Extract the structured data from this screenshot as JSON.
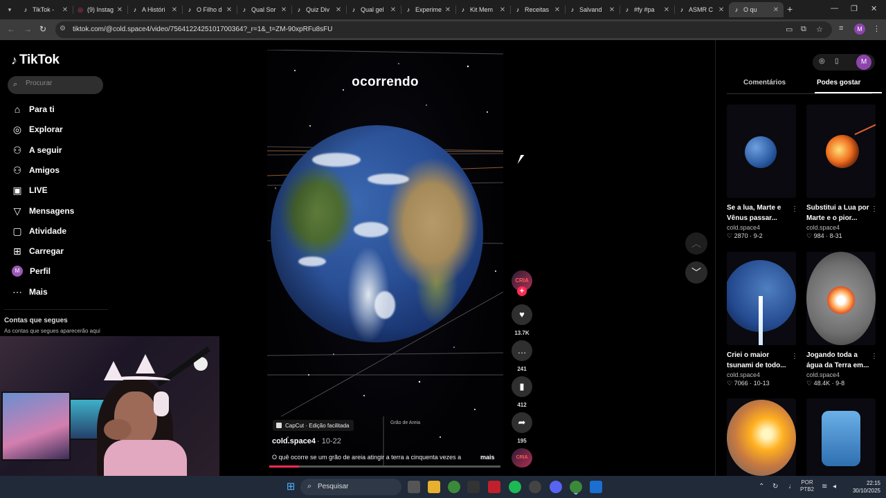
{
  "browser": {
    "tabs": [
      {
        "icon": "tiktok-icon",
        "title": "TikTok -"
      },
      {
        "icon": "instagram-icon",
        "title": "(9) Instag"
      },
      {
        "icon": "tiktok-icon",
        "title": "A Históri"
      },
      {
        "icon": "tiktok-icon",
        "title": "O Filho d"
      },
      {
        "icon": "tiktok-icon",
        "title": "Qual Sor"
      },
      {
        "icon": "tiktok-icon",
        "title": "Quiz Div"
      },
      {
        "icon": "tiktok-icon",
        "title": "Qual gel"
      },
      {
        "icon": "tiktok-icon",
        "title": "Experime"
      },
      {
        "icon": "tiktok-icon",
        "title": "Kit Mem"
      },
      {
        "icon": "tiktok-icon",
        "title": "Receitas"
      },
      {
        "icon": "tiktok-icon",
        "title": "Salvand"
      },
      {
        "icon": "tiktok-icon",
        "title": "#fy #pa"
      },
      {
        "icon": "tiktok-icon",
        "title": "ASMR C"
      },
      {
        "icon": "tiktok-icon",
        "title": "O qu",
        "active": true
      }
    ],
    "url": "tiktok.com/@cold.space4/video/7564122425101700364?_r=1&_t=ZM-90xpRFu8sFU",
    "profile_initial": "M"
  },
  "sidebar": {
    "logo": "TikTok",
    "search_placeholder": "Procurar",
    "items": [
      {
        "icon": "home-icon",
        "label": "Para ti"
      },
      {
        "icon": "compass-icon",
        "label": "Explorar"
      },
      {
        "icon": "following-icon",
        "label": "A seguir"
      },
      {
        "icon": "friends-icon",
        "label": "Amigos"
      },
      {
        "icon": "live-icon",
        "label": "LIVE"
      },
      {
        "icon": "messages-icon",
        "label": "Mensagens"
      },
      {
        "icon": "activity-icon",
        "label": "Atividade"
      },
      {
        "icon": "upload-icon",
        "label": "Carregar"
      },
      {
        "icon": "profile-avatar",
        "label": "Perfil",
        "initial": "M"
      },
      {
        "icon": "more-icon",
        "label": "Mais"
      }
    ],
    "following_heading": "Contas que segues",
    "following_hint": "As contas que segues aparecerão aqui"
  },
  "video": {
    "overlay_title": "ocorrendo",
    "capcut_label": "CapCut · Edição facilitada",
    "small_label": "Grão de Areia",
    "author": "cold.space4",
    "date": "· 10-22",
    "description": "O quê ocorre se um grão de areia atingir a terra a cinquenta vezes a",
    "more_label": "mais",
    "progress": 0.13
  },
  "actions": {
    "avatar_text": "CRIA",
    "likes": "13.7K",
    "comments": "241",
    "saves": "412",
    "shares": "195"
  },
  "right_panel": {
    "tabs": [
      "Comentários",
      "Podes gostar"
    ],
    "active_tab": "Podes gostar",
    "profile_initial": "M",
    "cards": [
      {
        "title": "Se a lua, Marte e Vênus passar...",
        "user": "cold.space4",
        "likes": "2870",
        "date": "9-2"
      },
      {
        "title": "Substitui a Lua por Marte e o pior...",
        "user": "cold.space4",
        "likes": "984",
        "date": "8-31"
      },
      {
        "title": "Criei o maior tsunami de todo...",
        "user": "cold.space4",
        "likes": "7066",
        "date": "10-13"
      },
      {
        "title": "Jogando toda a água da Terra em...",
        "user": "cold.space4",
        "likes": "48.4K",
        "date": "9-8"
      }
    ]
  },
  "taskbar": {
    "search_label": "Pesquisar",
    "lang_top": "POR",
    "lang_bottom": "PTB2",
    "time": "22:15",
    "date": "30/10/2025"
  },
  "colors": {
    "accent": "#fe2c55",
    "profile": "#8e44ad",
    "taskbar": "#202a38"
  }
}
